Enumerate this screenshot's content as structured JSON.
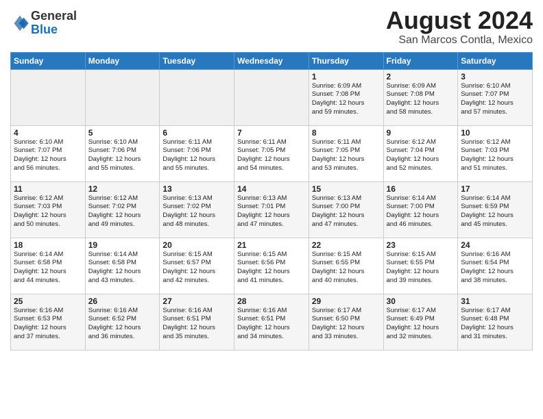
{
  "title": "August 2024",
  "subtitle": "San Marcos Contla, Mexico",
  "logo": {
    "line1": "General",
    "line2": "Blue"
  },
  "days_of_week": [
    "Sunday",
    "Monday",
    "Tuesday",
    "Wednesday",
    "Thursday",
    "Friday",
    "Saturday"
  ],
  "weeks": [
    [
      {
        "day": "",
        "info": ""
      },
      {
        "day": "",
        "info": ""
      },
      {
        "day": "",
        "info": ""
      },
      {
        "day": "",
        "info": ""
      },
      {
        "day": "1",
        "info": "Sunrise: 6:09 AM\nSunset: 7:08 PM\nDaylight: 12 hours\nand 59 minutes."
      },
      {
        "day": "2",
        "info": "Sunrise: 6:09 AM\nSunset: 7:08 PM\nDaylight: 12 hours\nand 58 minutes."
      },
      {
        "day": "3",
        "info": "Sunrise: 6:10 AM\nSunset: 7:07 PM\nDaylight: 12 hours\nand 57 minutes."
      }
    ],
    [
      {
        "day": "4",
        "info": "Sunrise: 6:10 AM\nSunset: 7:07 PM\nDaylight: 12 hours\nand 56 minutes."
      },
      {
        "day": "5",
        "info": "Sunrise: 6:10 AM\nSunset: 7:06 PM\nDaylight: 12 hours\nand 55 minutes."
      },
      {
        "day": "6",
        "info": "Sunrise: 6:11 AM\nSunset: 7:06 PM\nDaylight: 12 hours\nand 55 minutes."
      },
      {
        "day": "7",
        "info": "Sunrise: 6:11 AM\nSunset: 7:05 PM\nDaylight: 12 hours\nand 54 minutes."
      },
      {
        "day": "8",
        "info": "Sunrise: 6:11 AM\nSunset: 7:05 PM\nDaylight: 12 hours\nand 53 minutes."
      },
      {
        "day": "9",
        "info": "Sunrise: 6:12 AM\nSunset: 7:04 PM\nDaylight: 12 hours\nand 52 minutes."
      },
      {
        "day": "10",
        "info": "Sunrise: 6:12 AM\nSunset: 7:03 PM\nDaylight: 12 hours\nand 51 minutes."
      }
    ],
    [
      {
        "day": "11",
        "info": "Sunrise: 6:12 AM\nSunset: 7:03 PM\nDaylight: 12 hours\nand 50 minutes."
      },
      {
        "day": "12",
        "info": "Sunrise: 6:12 AM\nSunset: 7:02 PM\nDaylight: 12 hours\nand 49 minutes."
      },
      {
        "day": "13",
        "info": "Sunrise: 6:13 AM\nSunset: 7:02 PM\nDaylight: 12 hours\nand 48 minutes."
      },
      {
        "day": "14",
        "info": "Sunrise: 6:13 AM\nSunset: 7:01 PM\nDaylight: 12 hours\nand 47 minutes."
      },
      {
        "day": "15",
        "info": "Sunrise: 6:13 AM\nSunset: 7:00 PM\nDaylight: 12 hours\nand 47 minutes."
      },
      {
        "day": "16",
        "info": "Sunrise: 6:14 AM\nSunset: 7:00 PM\nDaylight: 12 hours\nand 46 minutes."
      },
      {
        "day": "17",
        "info": "Sunrise: 6:14 AM\nSunset: 6:59 PM\nDaylight: 12 hours\nand 45 minutes."
      }
    ],
    [
      {
        "day": "18",
        "info": "Sunrise: 6:14 AM\nSunset: 6:58 PM\nDaylight: 12 hours\nand 44 minutes."
      },
      {
        "day": "19",
        "info": "Sunrise: 6:14 AM\nSunset: 6:58 PM\nDaylight: 12 hours\nand 43 minutes."
      },
      {
        "day": "20",
        "info": "Sunrise: 6:15 AM\nSunset: 6:57 PM\nDaylight: 12 hours\nand 42 minutes."
      },
      {
        "day": "21",
        "info": "Sunrise: 6:15 AM\nSunset: 6:56 PM\nDaylight: 12 hours\nand 41 minutes."
      },
      {
        "day": "22",
        "info": "Sunrise: 6:15 AM\nSunset: 6:55 PM\nDaylight: 12 hours\nand 40 minutes."
      },
      {
        "day": "23",
        "info": "Sunrise: 6:15 AM\nSunset: 6:55 PM\nDaylight: 12 hours\nand 39 minutes."
      },
      {
        "day": "24",
        "info": "Sunrise: 6:16 AM\nSunset: 6:54 PM\nDaylight: 12 hours\nand 38 minutes."
      }
    ],
    [
      {
        "day": "25",
        "info": "Sunrise: 6:16 AM\nSunset: 6:53 PM\nDaylight: 12 hours\nand 37 minutes."
      },
      {
        "day": "26",
        "info": "Sunrise: 6:16 AM\nSunset: 6:52 PM\nDaylight: 12 hours\nand 36 minutes."
      },
      {
        "day": "27",
        "info": "Sunrise: 6:16 AM\nSunset: 6:51 PM\nDaylight: 12 hours\nand 35 minutes."
      },
      {
        "day": "28",
        "info": "Sunrise: 6:16 AM\nSunset: 6:51 PM\nDaylight: 12 hours\nand 34 minutes."
      },
      {
        "day": "29",
        "info": "Sunrise: 6:17 AM\nSunset: 6:50 PM\nDaylight: 12 hours\nand 33 minutes."
      },
      {
        "day": "30",
        "info": "Sunrise: 6:17 AM\nSunset: 6:49 PM\nDaylight: 12 hours\nand 32 minutes."
      },
      {
        "day": "31",
        "info": "Sunrise: 6:17 AM\nSunset: 6:48 PM\nDaylight: 12 hours\nand 31 minutes."
      }
    ]
  ]
}
